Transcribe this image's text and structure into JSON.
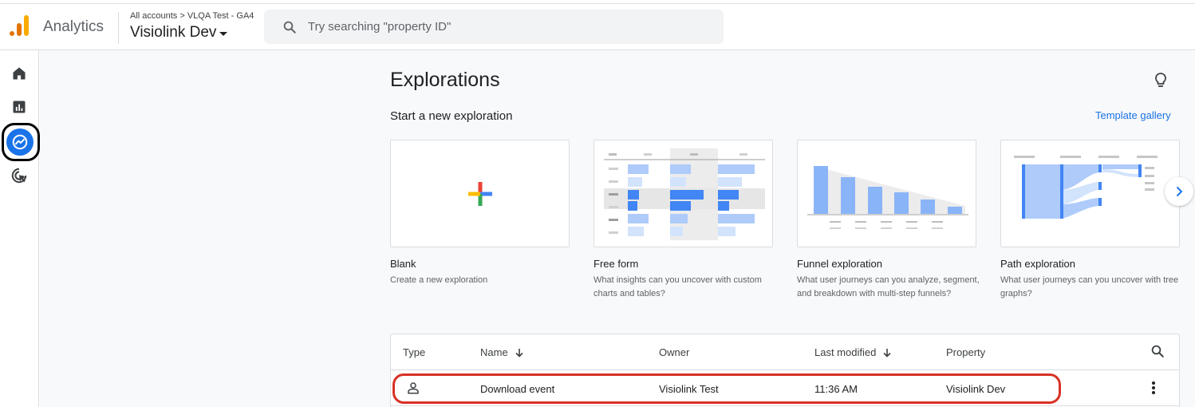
{
  "header": {
    "app_name": "Analytics",
    "breadcrumb": "All accounts > VLQA Test - GA4",
    "property_name": "Visiolink Dev",
    "search_placeholder": "Try searching \"property ID\""
  },
  "nav": {
    "items": [
      {
        "icon": "home-icon"
      },
      {
        "icon": "reports-icon"
      },
      {
        "icon": "explore-icon",
        "active": true
      },
      {
        "icon": "advertising-icon"
      }
    ]
  },
  "page": {
    "title": "Explorations",
    "section_title": "Start a new exploration",
    "template_gallery": "Template gallery"
  },
  "templates": [
    {
      "title": "Blank",
      "description": "Create a new exploration"
    },
    {
      "title": "Free form",
      "description": "What insights can you uncover with custom charts and tables?"
    },
    {
      "title": "Funnel exploration",
      "description": "What user journeys can you analyze, segment, and breakdown with multi-step funnels?"
    },
    {
      "title": "Path exploration",
      "description": "What user journeys can you uncover with tree graphs?"
    }
  ],
  "table": {
    "columns": {
      "type": "Type",
      "name": "Name",
      "owner": "Owner",
      "last_modified": "Last modified",
      "property": "Property"
    },
    "rows": [
      {
        "name": "Download event",
        "owner": "Visiolink Test",
        "last_modified": "11:36 AM",
        "property": "Visiolink Dev"
      }
    ]
  },
  "colors": {
    "accent": "#1a73e8",
    "logo_orange": "#e37400",
    "logo_yellow": "#f9ab00",
    "highlight_red": "#d93025"
  }
}
